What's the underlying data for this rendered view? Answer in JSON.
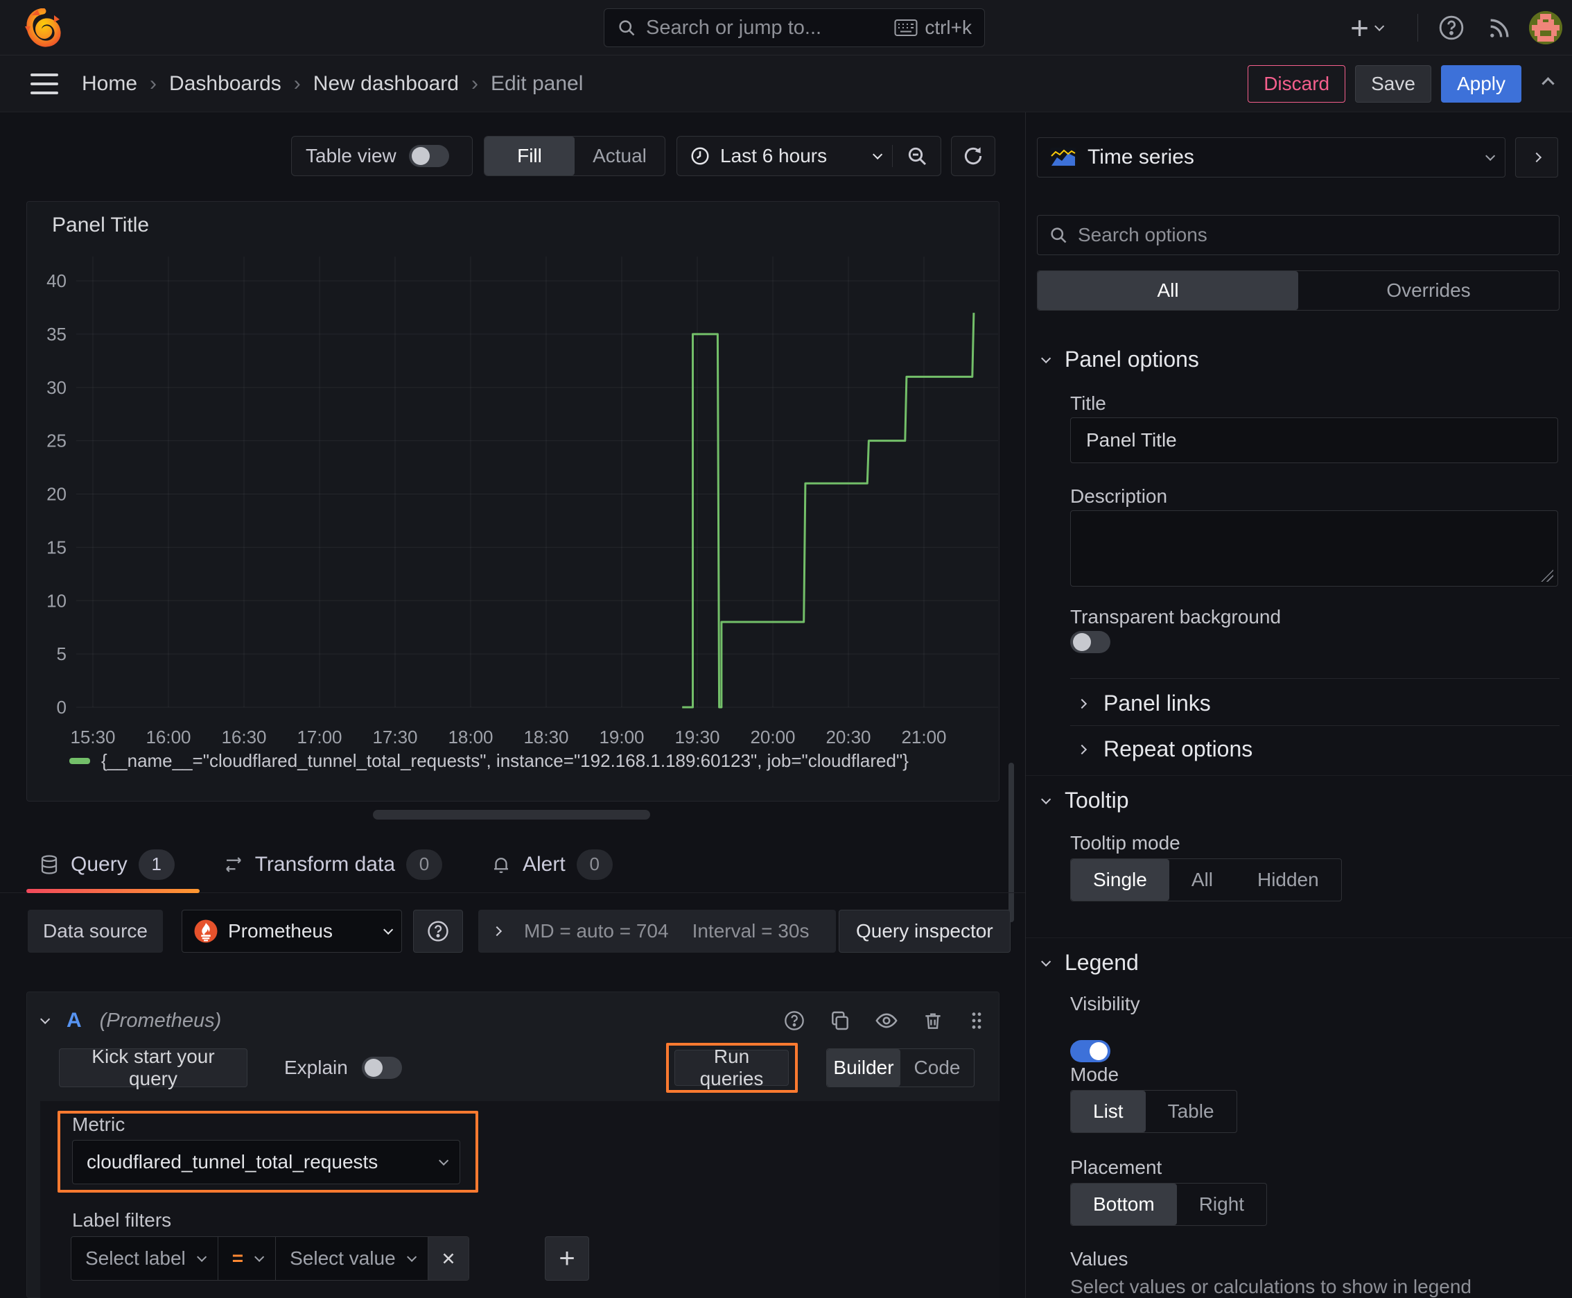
{
  "topbar": {
    "search_placeholder": "Search or jump to...",
    "shortcut": "ctrl+k"
  },
  "breadcrumb": {
    "items": [
      "Home",
      "Dashboards",
      "New dashboard",
      "Edit panel"
    ]
  },
  "actions": {
    "discard": "Discard",
    "save": "Save",
    "apply": "Apply"
  },
  "toolbar": {
    "table_view": "Table view",
    "fill": "Fill",
    "actual": "Actual",
    "time_range": "Last 6 hours"
  },
  "viz_picker": {
    "label": "Time series"
  },
  "options": {
    "search_placeholder": "Search options",
    "tab_all": "All",
    "tab_overrides": "Overrides"
  },
  "panel_options": {
    "heading": "Panel options",
    "title_label": "Title",
    "title_value": "Panel Title",
    "description_label": "Description",
    "transparent_label": "Transparent background"
  },
  "collapsed_sections": {
    "panel_links": "Panel links",
    "repeat_options": "Repeat options"
  },
  "tooltip_section": {
    "heading": "Tooltip",
    "mode_label": "Tooltip mode",
    "options": [
      "Single",
      "All",
      "Hidden"
    ],
    "selected": "Single"
  },
  "legend_section": {
    "heading": "Legend",
    "visibility_label": "Visibility",
    "mode_label": "Mode",
    "mode_options": [
      "List",
      "Table"
    ],
    "placement_label": "Placement",
    "placement_options": [
      "Bottom",
      "Right"
    ],
    "values_label": "Values",
    "values_description": "Select values or calculations to show in legend"
  },
  "query_tabs": {
    "query": "Query",
    "query_count": "1",
    "transform": "Transform data",
    "transform_count": "0",
    "alert": "Alert",
    "alert_count": "0"
  },
  "datasource": {
    "label": "Data source",
    "name": "Prometheus",
    "stats_md": "MD = auto = 704",
    "stats_interval": "Interval = 30s",
    "inspector": "Query inspector"
  },
  "query_row": {
    "ref_id": "A",
    "ds_hint": "(Prometheus)",
    "kick_start": "Kick start your query",
    "explain": "Explain",
    "run_queries": "Run queries",
    "builder": "Builder",
    "code": "Code",
    "metric_label": "Metric",
    "metric_value": "cloudflared_tunnel_total_requests",
    "label_filters_label": "Label filters",
    "select_label_placeholder": "Select label",
    "operator": "=",
    "select_value_placeholder": "Select value",
    "remove_label": "x"
  },
  "panel": {
    "title": "Panel Title",
    "legend_text": "{__name__=\"cloudflared_tunnel_total_requests\", instance=\"192.168.1.189:60123\", job=\"cloudflared\"}"
  },
  "chart_data": {
    "type": "line",
    "title": "Panel Title",
    "x_ticks": [
      "15:30",
      "16:00",
      "16:30",
      "17:00",
      "17:30",
      "18:00",
      "18:30",
      "19:00",
      "19:30",
      "20:00",
      "20:30",
      "21:00"
    ],
    "x_tick_hours": [
      15.5,
      16,
      16.5,
      17,
      17.5,
      18,
      18.5,
      19,
      19.5,
      20,
      20.5,
      21
    ],
    "x_range_hours": [
      15.39,
      21.49
    ],
    "y_ticks": [
      0,
      5,
      10,
      15,
      20,
      25,
      30,
      35,
      40
    ],
    "ylim": [
      0,
      40
    ],
    "grid": true,
    "legend_position": "bottom",
    "series": [
      {
        "name": "{__name__=\"cloudflared_tunnel_total_requests\", instance=\"192.168.1.189:60123\", job=\"cloudflared\"}",
        "color": "#73bf69",
        "points": [
          [
            19.4,
            0
          ],
          [
            19.47,
            0
          ],
          [
            19.47,
            35
          ],
          [
            19.635,
            35
          ],
          [
            19.645,
            0
          ],
          [
            19.66,
            0
          ],
          [
            19.66,
            8
          ],
          [
            20.205,
            8
          ],
          [
            20.215,
            21
          ],
          [
            20.625,
            21
          ],
          [
            20.635,
            25
          ],
          [
            20.875,
            25
          ],
          [
            20.885,
            31
          ],
          [
            21.32,
            31
          ],
          [
            21.33,
            37
          ]
        ]
      }
    ]
  },
  "colors": {
    "green": "#73bf69",
    "accent_orange": "#ff8833",
    "annotation_orange": "#ff7a30",
    "apply_blue": "#3d71d9",
    "discard_pink": "#f55f8d"
  }
}
